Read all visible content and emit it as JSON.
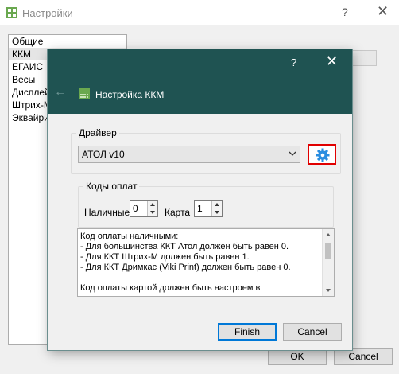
{
  "settings_window": {
    "title": "Настройки",
    "help_glyph": "?",
    "close_glyph": "✕",
    "sidebar_items": [
      {
        "label": "Общие"
      },
      {
        "label": "ККМ"
      },
      {
        "label": "ЕГАИС"
      },
      {
        "label": "Весы"
      },
      {
        "label": "Дисплей"
      },
      {
        "label": "Штрих-М"
      },
      {
        "label": "Эквайринг"
      }
    ],
    "selected_item": "ККМ",
    "ok_label": "OK",
    "cancel_label": "Cancel"
  },
  "dialog": {
    "help_glyph": "?",
    "close_glyph": "✕",
    "back_glyph": "←",
    "title": "Настройка ККМ",
    "driver_group": {
      "label": "Драйвер",
      "selected_driver": "АТОЛ v10",
      "settings_icon": "gear-icon"
    },
    "codes_group": {
      "label": "Коды оплат",
      "cash_label": "Наличные",
      "cash_value": "0",
      "card_label": "Карта",
      "card_value": "1"
    },
    "info_lines": [
      "Код оплаты наличными:",
      "- Для большинства ККТ Атол должен быть равен 0.",
      "- Для ККТ Штрих-М должен быть равен 1.",
      "- Для ККТ Дримкас (Viki Print) должен быть равен 0.",
      "",
      "Код оплаты картой должен быть настроем в"
    ],
    "finish_label": "Finish",
    "cancel_label": "Cancel"
  },
  "colors": {
    "header_teal": "#1f5352",
    "highlight_red": "#e10000",
    "gear_blue": "#2a8de0",
    "app_icon_green": "#6aa84f"
  }
}
